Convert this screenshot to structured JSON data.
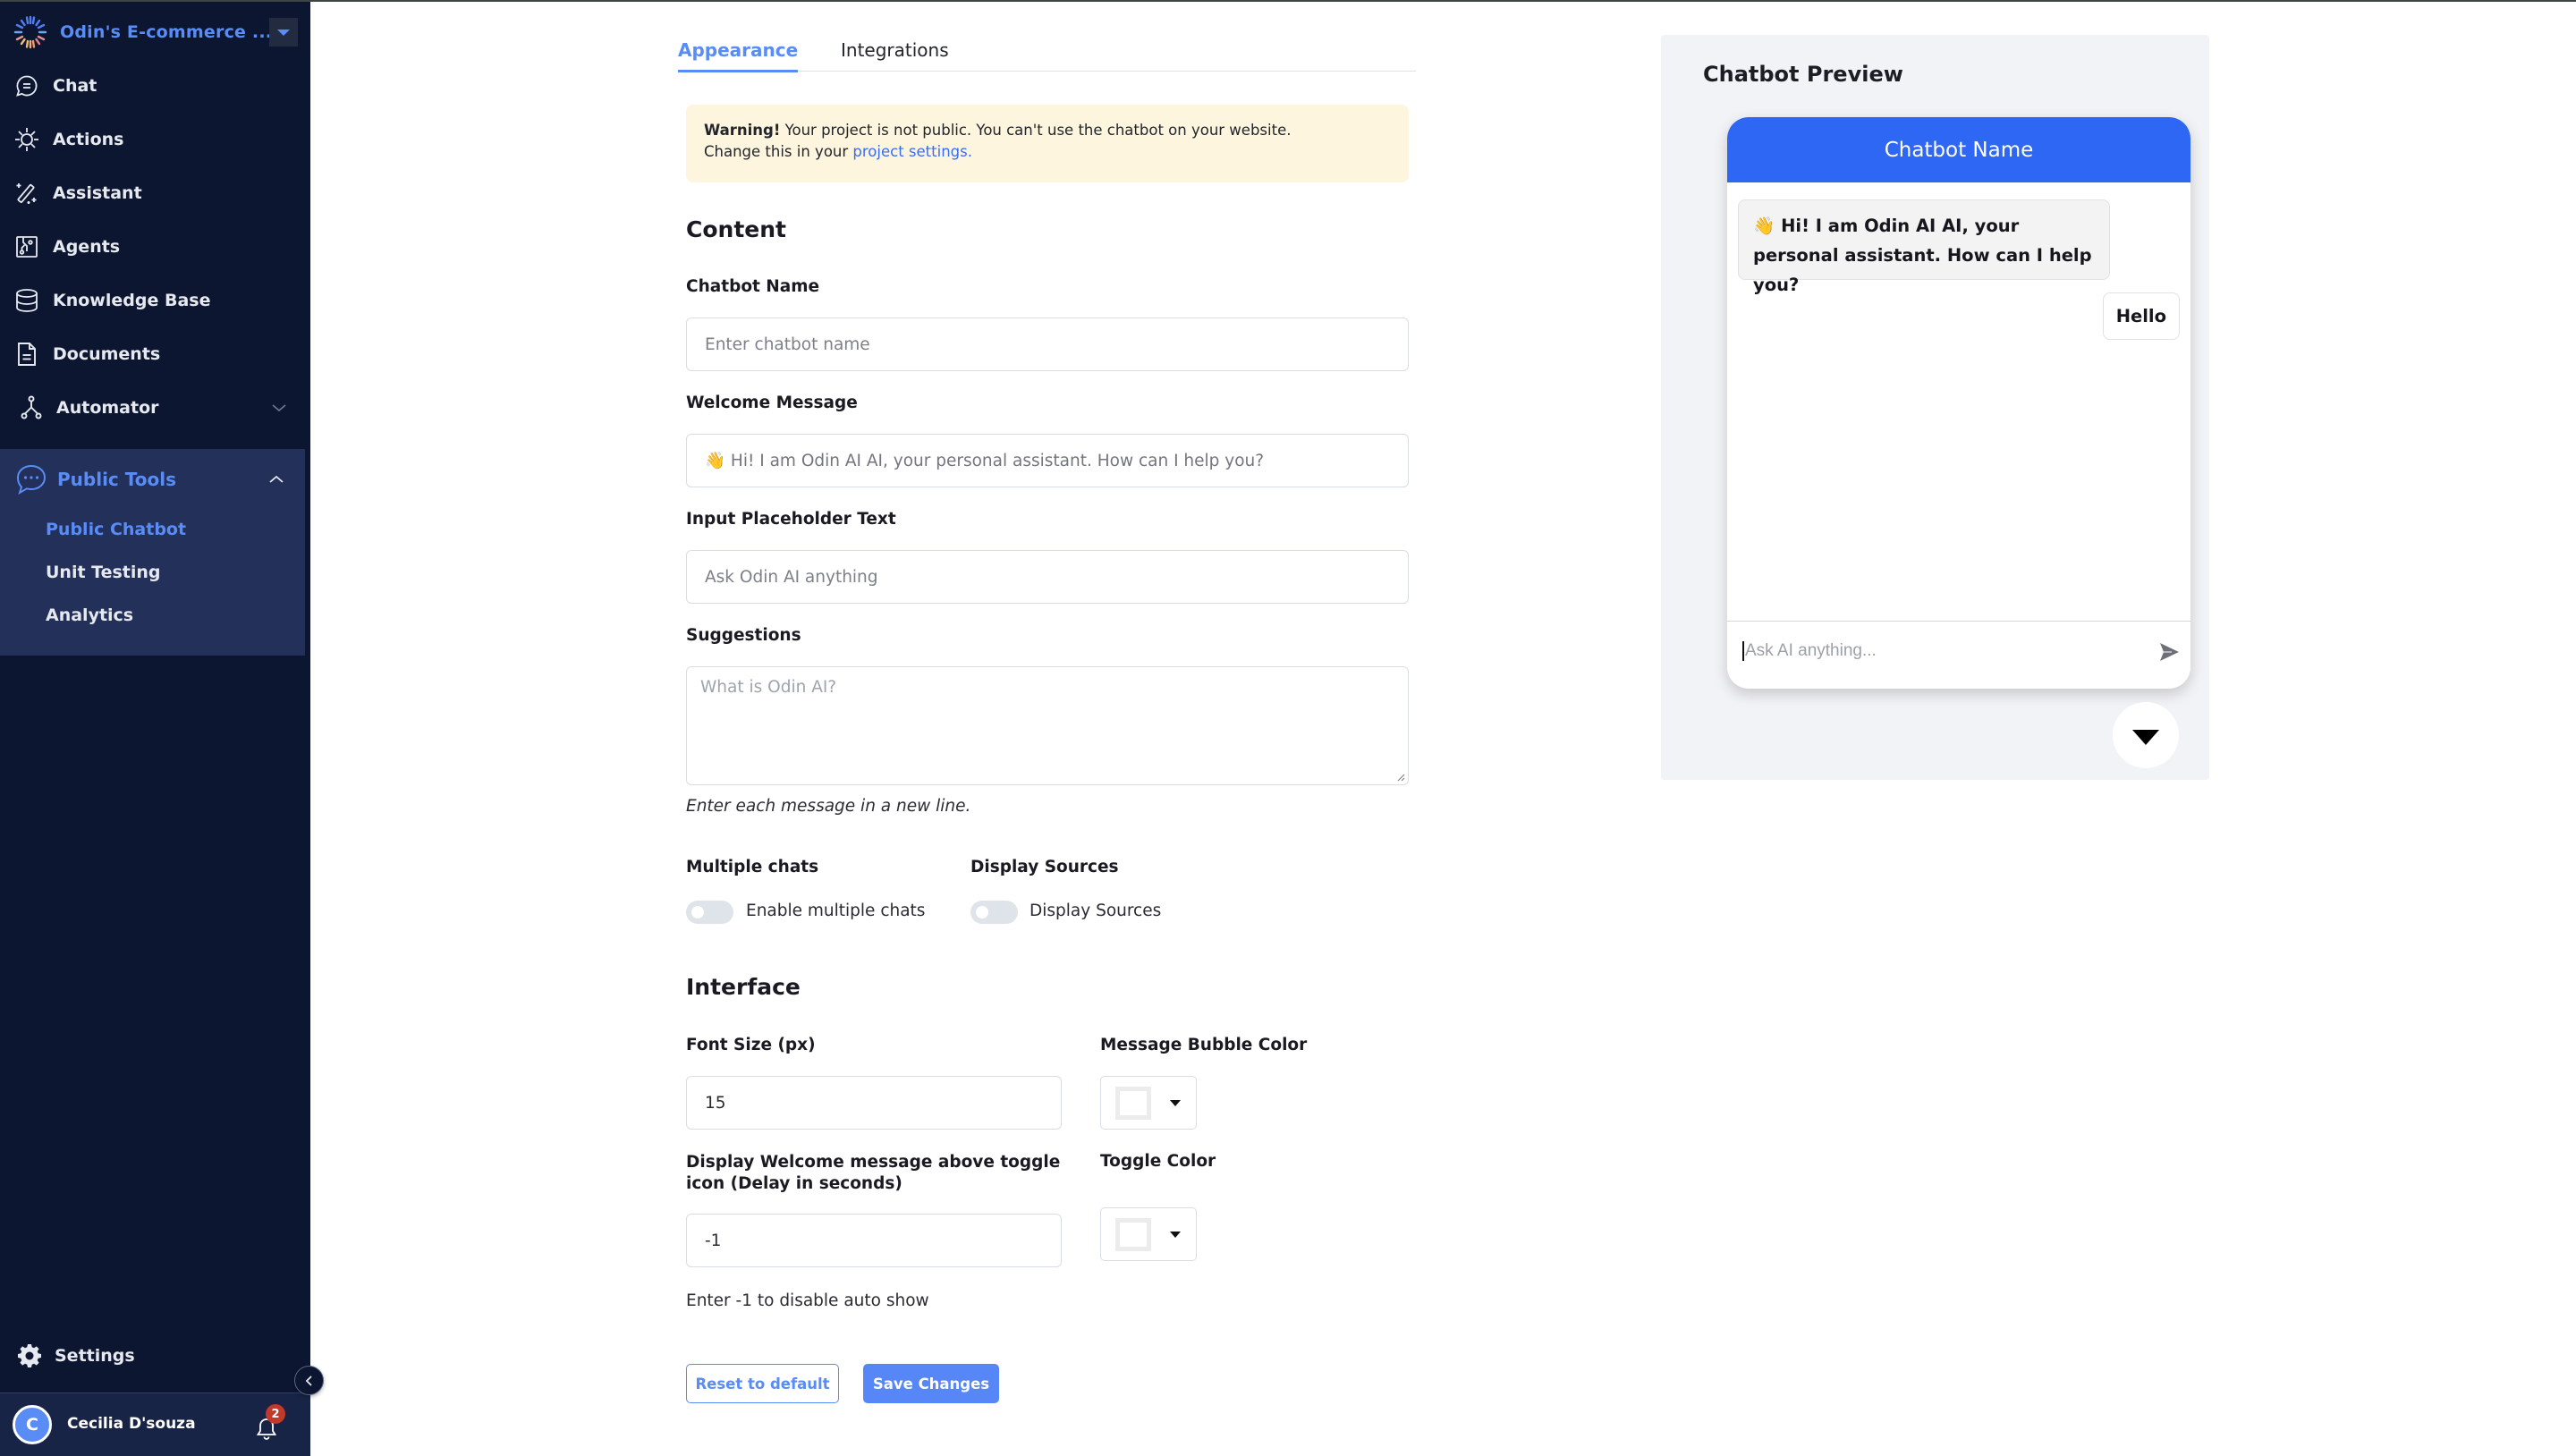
{
  "sidebar": {
    "project_name": "Odin's E-commerce ...",
    "items": [
      {
        "label": "Chat",
        "icon": "chat-bubble-icon"
      },
      {
        "label": "Actions",
        "icon": "sun-gear-icon"
      },
      {
        "label": "Assistant",
        "icon": "magic-wand-icon"
      },
      {
        "label": "Agents",
        "icon": "circuit-board-icon"
      },
      {
        "label": "Knowledge Base",
        "icon": "database-icon"
      },
      {
        "label": "Documents",
        "icon": "document-icon"
      },
      {
        "label": "Automator",
        "icon": "flow-branch-icon",
        "expandable": true
      }
    ],
    "public_tools": {
      "label": "Public Tools",
      "icon": "chat-dots-icon",
      "expanded": true,
      "children": [
        {
          "label": "Public Chatbot",
          "active": true
        },
        {
          "label": "Unit Testing",
          "active": false
        },
        {
          "label": "Analytics",
          "active": false
        }
      ]
    },
    "settings_label": "Settings",
    "user": {
      "initial": "C",
      "name": "Cecilia D'souza",
      "notification_count": "2"
    }
  },
  "tabs": [
    {
      "label": "Appearance",
      "active": true
    },
    {
      "label": "Integrations",
      "active": false
    }
  ],
  "warning": {
    "strong": "Warning!",
    "text": " Your project is not public. You can't use the chatbot on your website.",
    "line2": "Change this in your ",
    "link": "project settings."
  },
  "content": {
    "heading": "Content",
    "chatbot_name": {
      "label": "Chatbot Name",
      "value": "",
      "placeholder": "Enter chatbot name"
    },
    "welcome_message": {
      "label": "Welcome Message",
      "value": "👋 Hi! I am Odin AI AI, your personal assistant. How can I help you?"
    },
    "input_placeholder": {
      "label": "Input Placeholder Text",
      "value": "",
      "placeholder": "Ask Odin AI anything"
    },
    "suggestions": {
      "label": "Suggestions",
      "value": "",
      "placeholder": "What is Odin AI?",
      "hint": "Enter each message in a new line."
    },
    "multiple_chats": {
      "label": "Multiple chats",
      "toggle_label": "Enable multiple chats",
      "enabled": false
    },
    "display_sources": {
      "label": "Display Sources",
      "toggle_label": "Display Sources",
      "enabled": false
    }
  },
  "interface": {
    "heading": "Interface",
    "font_size": {
      "label": "Font Size (px)",
      "value": "15"
    },
    "bubble_color": {
      "label": "Message Bubble Color",
      "value": "#ffffff"
    },
    "welcome_delay": {
      "label": "Display Welcome message above toggle icon (Delay in seconds)",
      "value": "-1",
      "hint": "Enter -1 to disable auto show"
    },
    "toggle_color": {
      "label": "Toggle Color",
      "value": "#ffffff"
    }
  },
  "actions": {
    "reset_label": "Reset to default",
    "save_label": "Save Changes"
  },
  "preview": {
    "title": "Chatbot Preview",
    "chatbot_name": "Chatbot Name",
    "header_color": "#2f67f5",
    "bot_message": "👋 Hi! I am Odin AI AI, your personal assistant. How can I help you?",
    "user_message": "Hello",
    "input_placeholder": "Ask AI anything..."
  },
  "colors": {
    "accent": "#5a8cf5",
    "sidebar_bg": "#0c1631",
    "warning_bg": "#fdf5de",
    "badge": "#c0392b"
  }
}
